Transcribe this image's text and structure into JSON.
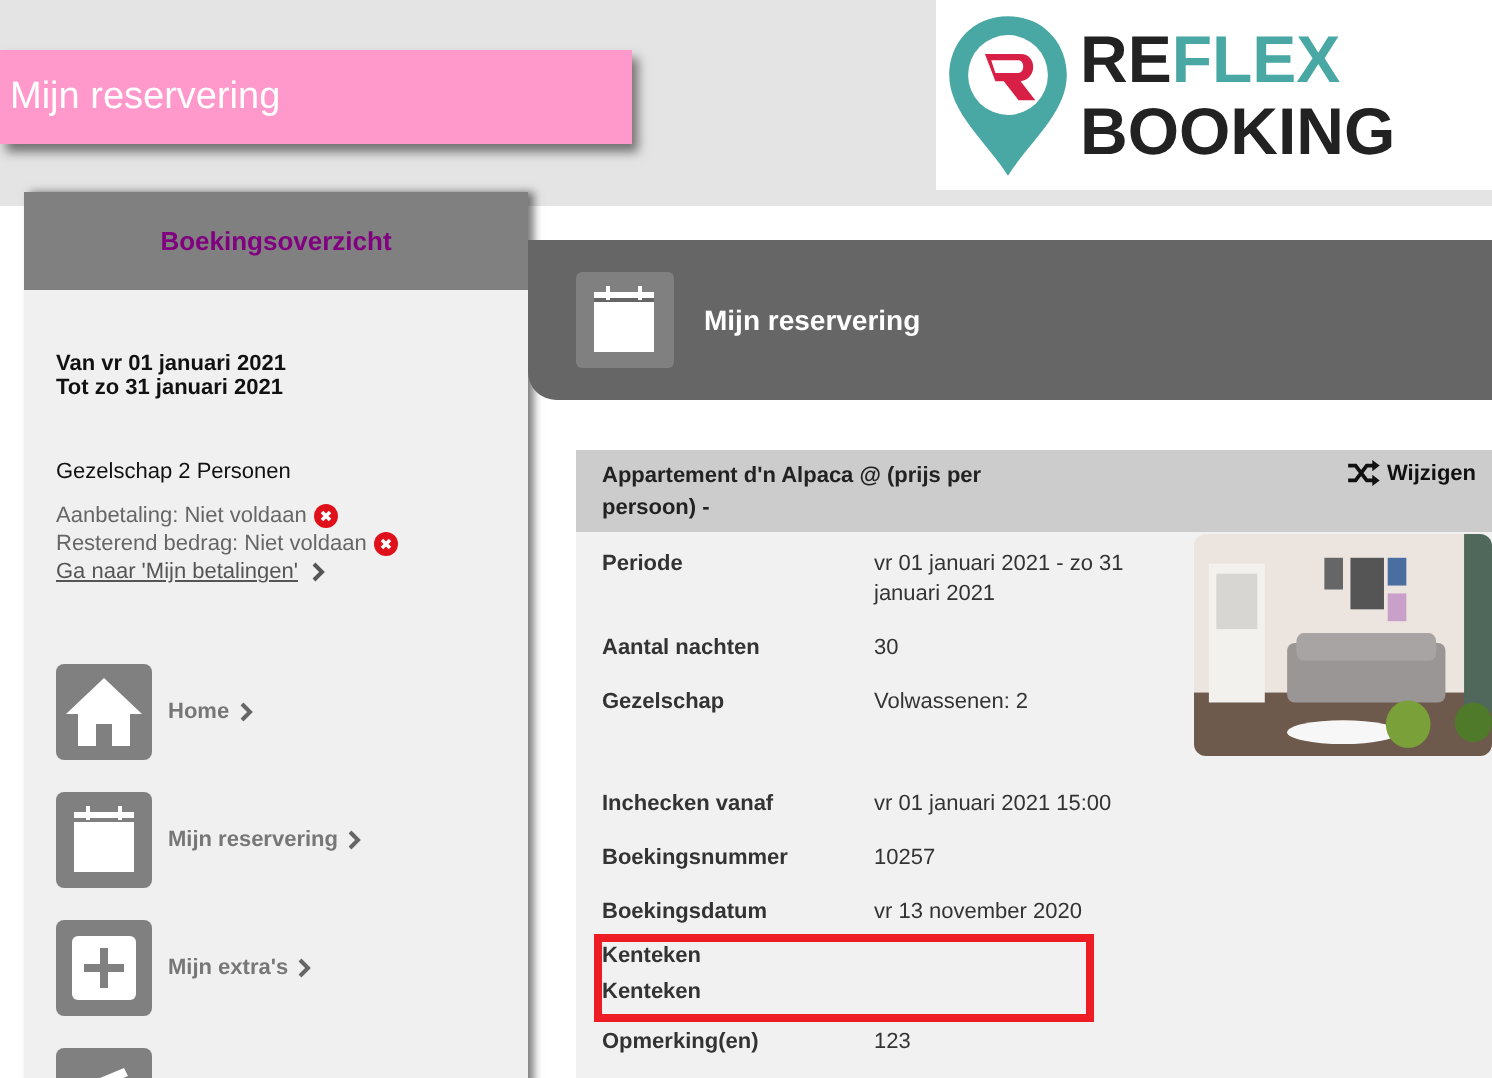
{
  "header": {
    "title": "Mijn reservering"
  },
  "logo": {
    "word1": "RE",
    "word2": "FLEX",
    "word3": "BOOKING"
  },
  "sidebar": {
    "title": "Boekingsoverzicht",
    "dates": [
      "Van vr 01 januari 2021",
      "Tot zo 31 januari 2021"
    ],
    "party": "Gezelschap 2 Personen",
    "payments": [
      {
        "label": "Aanbetaling: Niet voldaan",
        "paid": false
      },
      {
        "label": "Resterend bedrag: Niet voldaan",
        "paid": false
      }
    ],
    "payments_link": "Ga naar 'Mijn betalingen'",
    "nav": [
      {
        "kind": "home",
        "label": "Home"
      },
      {
        "kind": "calendar",
        "label": "Mijn reservering"
      },
      {
        "kind": "plus",
        "label": "Mijn extra's"
      },
      {
        "kind": "card"
      }
    ]
  },
  "banner": {
    "title": "Mijn reservering"
  },
  "card": {
    "title": "Appartement d'n Alpaca @ (prijs per persoon) -",
    "action": "Wijzigen",
    "top_rows": [
      {
        "label": "Periode",
        "value": "vr 01 januari 2021 - zo 31 januari 2021"
      },
      {
        "label": "Aantal nachten",
        "value": "30"
      },
      {
        "label": "Gezelschap",
        "value": "Volwassenen: 2"
      }
    ],
    "rows": [
      {
        "label": "Inchecken vanaf",
        "value": "vr 01 januari 2021 15:00",
        "highlighted": false
      },
      {
        "label": "Boekingsnummer",
        "value": "10257",
        "highlighted": false
      },
      {
        "label": "Boekingsdatum",
        "value": "vr 13 november 2020",
        "highlighted": false
      },
      {
        "label": "Kenteken",
        "highlighted": true
      },
      {
        "label": "Kenteken",
        "highlighted": true
      },
      {
        "label": "Opmerking(en)",
        "value": "123",
        "highlighted": false
      }
    ]
  }
}
